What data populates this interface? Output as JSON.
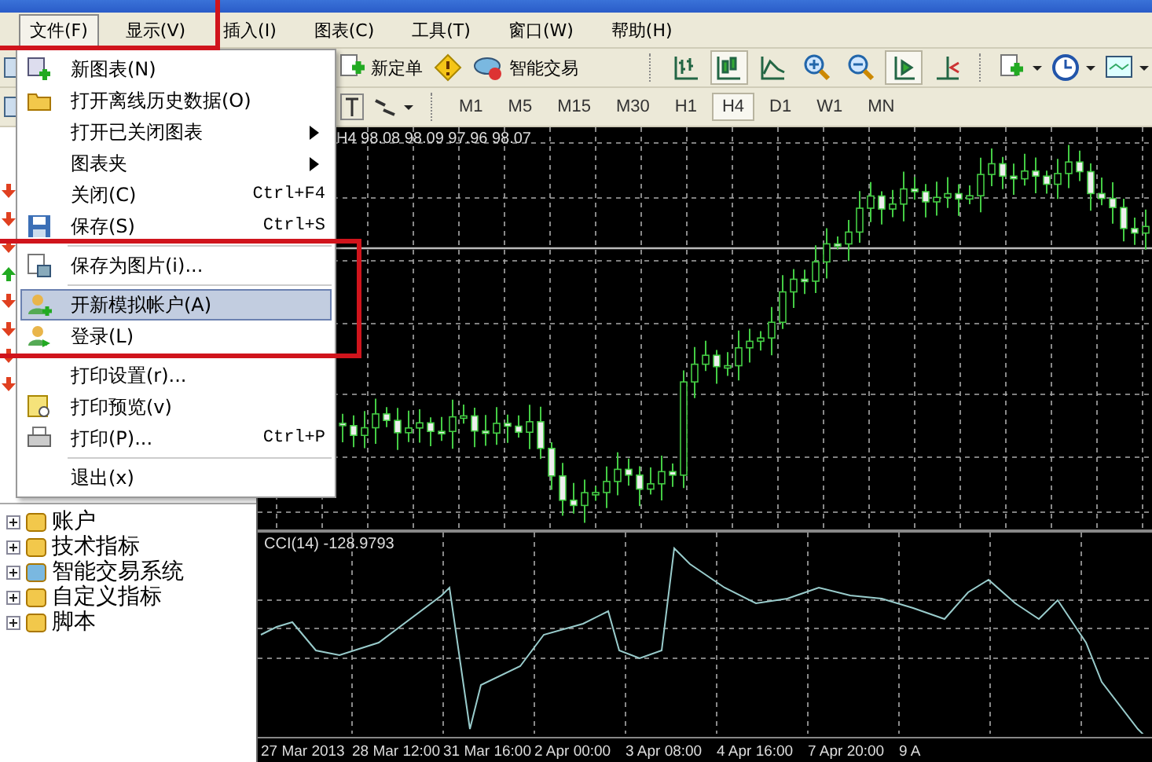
{
  "menu_bar": [
    {
      "label": "文件(F)",
      "selected": true
    },
    {
      "label": "显示(V)",
      "selected": false
    },
    {
      "label": "插入(I)",
      "selected": false
    },
    {
      "label": "图表(C)",
      "selected": false
    },
    {
      "label": "工具(T)",
      "selected": false
    },
    {
      "label": "窗口(W)",
      "selected": false
    },
    {
      "label": "帮助(H)",
      "selected": false
    }
  ],
  "toolbar": {
    "buttons": [
      {
        "label": "新定单"
      },
      {
        "label": "智能交易"
      }
    ],
    "chart_tools": [
      {
        "pressed": false
      },
      {
        "pressed": true
      },
      {
        "pressed": false
      },
      {
        "pressed": false
      },
      {
        "pressed": false
      },
      {
        "pressed": true
      },
      {
        "pressed": false
      }
    ]
  },
  "timeframes": [
    {
      "label": "M1",
      "selected": false
    },
    {
      "label": "M5",
      "selected": false
    },
    {
      "label": "M15",
      "selected": false
    },
    {
      "label": "M30",
      "selected": false
    },
    {
      "label": "H1",
      "selected": false
    },
    {
      "label": "H4",
      "selected": true
    },
    {
      "label": "D1",
      "selected": false
    },
    {
      "label": "W1",
      "selected": false
    },
    {
      "label": "MN",
      "selected": false
    }
  ],
  "file_menu": {
    "groups": [
      [
        {
          "label": "新图表(N)",
          "submenu": false,
          "selected": false
        },
        {
          "label": "打开离线历史数据(O)",
          "submenu": false,
          "selected": false
        },
        {
          "label": "打开已关闭图表",
          "submenu": true,
          "selected": false
        },
        {
          "label": "图表夹",
          "submenu": true,
          "selected": false
        },
        {
          "label": "关闭(C)",
          "shortcut": "Ctrl+F4",
          "submenu": false,
          "selected": false
        },
        {
          "label": "保存(S)",
          "shortcut": "Ctrl+S",
          "submenu": false,
          "selected": false
        }
      ],
      [
        {
          "label": "保存为图片(i)...",
          "submenu": false,
          "selected": false
        }
      ],
      [
        {
          "label": "开新模拟帐户(A)",
          "submenu": false,
          "selected": true
        },
        {
          "label": "登录(L)",
          "submenu": false,
          "selected": false
        }
      ],
      [
        {
          "label": "打印设置(r)...",
          "submenu": false,
          "selected": false
        },
        {
          "label": "打印预览(v)",
          "submenu": false,
          "selected": false
        },
        {
          "label": "打印(P)...",
          "shortcut": "Ctrl+P",
          "submenu": false,
          "selected": false
        }
      ],
      [
        {
          "label": "退出(x)",
          "submenu": false,
          "selected": false
        }
      ]
    ]
  },
  "quote_arrows": [
    {
      "up": false
    },
    {
      "up": false
    },
    {
      "up": false
    },
    {
      "up": true
    },
    {
      "up": false
    },
    {
      "up": false
    },
    {
      "up": false
    },
    {
      "up": false
    }
  ],
  "navigator": [
    {
      "label": "账户",
      "expanded": false
    },
    {
      "label": "技术指标",
      "expanded": false
    },
    {
      "label": "智能交易系统",
      "expanded": false
    },
    {
      "label": "自定义指标",
      "expanded": false
    },
    {
      "label": "脚本",
      "expanded": false
    }
  ],
  "chart": {
    "header": "H4 98.08 98.09 97.96 98.07",
    "indicator_label": "CCI(14) -128.9793",
    "time_labels": [
      "27 Mar 2013",
      "28 Mar 12:00",
      "31 Mar 16:00",
      "2 Apr 00:00",
      "3 Apr 08:00",
      "4 Apr 16:00",
      "7 Apr 20:00",
      "9 A"
    ]
  }
}
